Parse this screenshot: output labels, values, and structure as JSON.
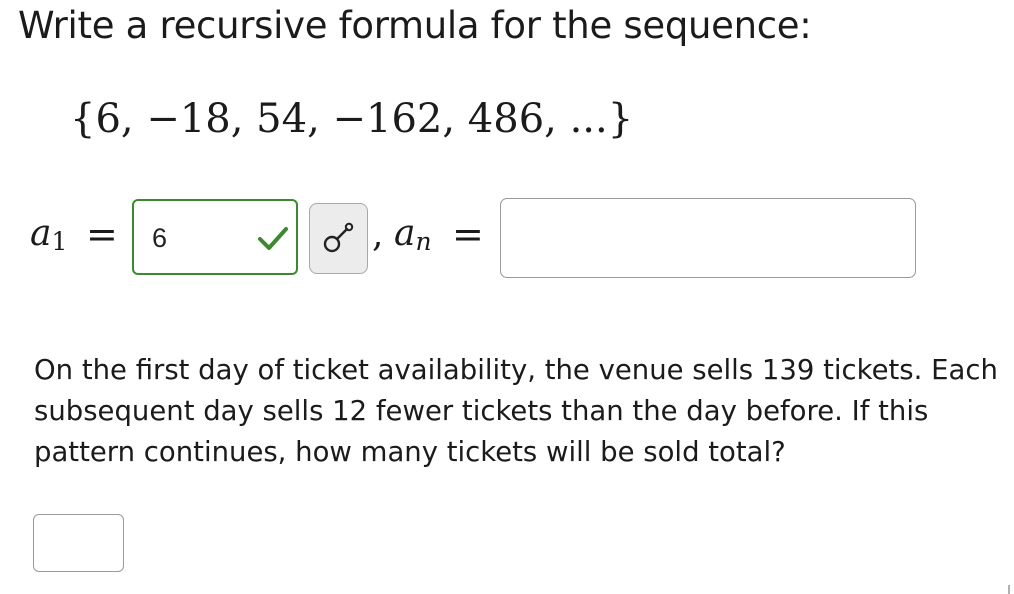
{
  "question1": {
    "prompt": "Write a recursive formula for the sequence:",
    "sequence": "{6, −18, 54, −162, 486, ...}",
    "a1_label": "a",
    "a1_subscript": "1",
    "equals": "=",
    "a1_value": "6",
    "a1_status": "correct",
    "comma": ",",
    "an_label": "a",
    "an_subscript": "n",
    "an_value": ""
  },
  "question2": {
    "lines": [
      "On the first day of ticket availability, the venue sells 139 tickets. Each",
      "subsequent day sells 12 fewer tickets than the day before. If this",
      "pattern continues, how many tickets will be sold total?"
    ],
    "answer_value": ""
  },
  "icons": {
    "status": "checkmark-icon",
    "help_button": "equation-editor-icon"
  },
  "colors": {
    "correct_border": "#3c8a2e",
    "correct_check": "#3c8a2e",
    "input_border": "#9a9a9a",
    "button_bg": "#ececec"
  }
}
